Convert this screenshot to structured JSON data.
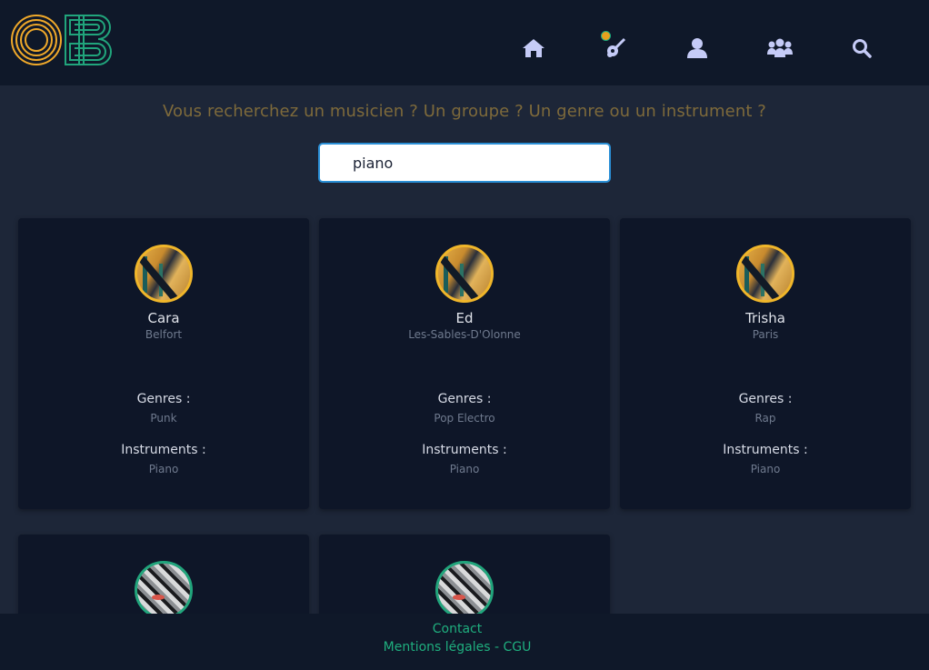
{
  "header": {
    "logo_text": "OB",
    "nav": {
      "home": "home-icon",
      "instrument": "guitar-icon",
      "profile": "user-icon",
      "groups": "group-icon",
      "search": "search-icon"
    }
  },
  "search": {
    "prompt": "Vous recherchez un musicien ? Un groupe ? Un genre ou un instrument ?",
    "value": "piano"
  },
  "labels": {
    "genres": "Genres :",
    "instruments": "Instruments :"
  },
  "results": [
    {
      "name": "Cara",
      "city": "Belfort",
      "genres": "Punk",
      "instruments": "Piano"
    },
    {
      "name": "Ed",
      "city": "Les-Sables-D'Olonne",
      "genres": "Pop Electro",
      "instruments": "Piano"
    },
    {
      "name": "Trisha",
      "city": "Paris",
      "genres": "Rap",
      "instruments": "Piano"
    }
  ],
  "footer": {
    "contact": "Contact",
    "legal": "Mentions légales - CGU"
  },
  "colors": {
    "accent_gold": "#f0b62a",
    "accent_green": "#1fae7e",
    "header_bg": "#0f1829",
    "page_bg": "#1d2638",
    "nav_icon": "#c5cbf7"
  }
}
